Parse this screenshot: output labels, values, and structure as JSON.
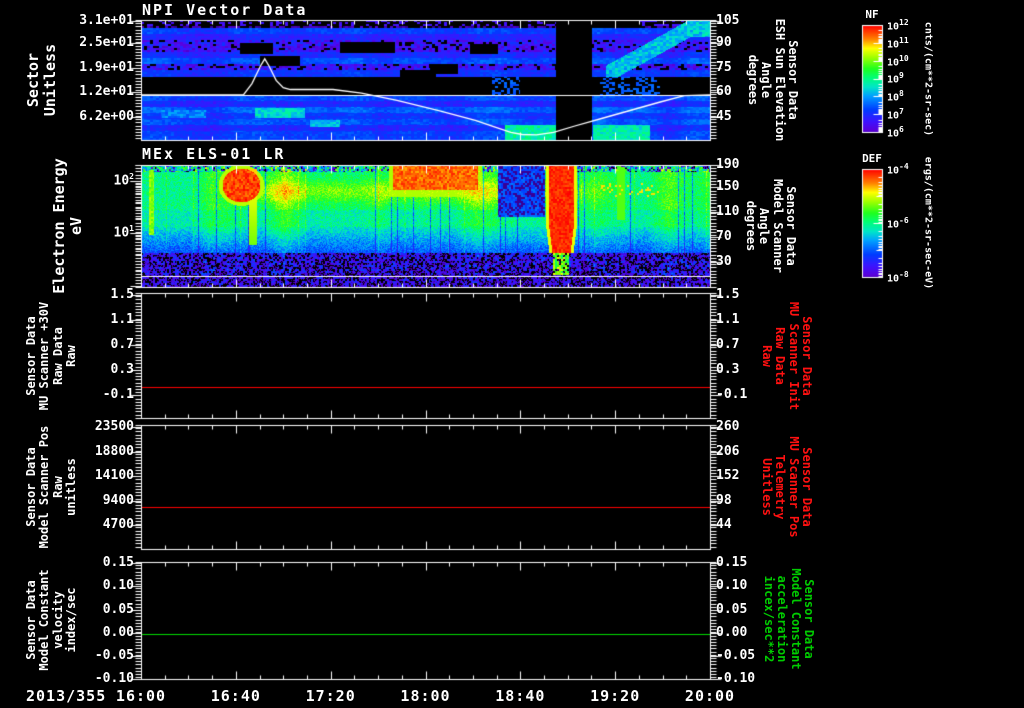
{
  "window": {
    "background": "#000000"
  },
  "date_label": "2013/355",
  "x_axis": {
    "tick_labels": [
      "16:00",
      "16:40",
      "17:20",
      "18:00",
      "18:40",
      "19:20",
      "20:00"
    ]
  },
  "colors": {
    "line_red": "#ff0000",
    "line_green": "#00dd00",
    "axis_white": "#ffffff",
    "title_red": "#ff1111",
    "title_green": "#00cc00"
  },
  "panels": [
    {
      "id": "npi",
      "title": "NPI Vector Data",
      "type": "spectrogram",
      "left_axis": {
        "title": "Sector\nUnitless",
        "ticks": [
          "3.1e+01",
          "2.5e+01",
          "1.9e+01",
          "1.2e+01",
          "6.2e+00"
        ],
        "fracs": [
          0.01,
          0.19,
          0.4,
          0.6,
          0.81
        ]
      },
      "right_axis": {
        "title": "Sensor Data\nESH Sun Elevation\nAngle\ndegrees",
        "color": "#ffffff",
        "ticks": [
          "105",
          "90",
          "75",
          "60",
          "45"
        ],
        "fracs": [
          0.01,
          0.19,
          0.4,
          0.6,
          0.81
        ]
      },
      "colorbar": {
        "title": "NF",
        "units": "cnts/(cm**2-sr-sec)",
        "tick_exponents": [
          "12",
          "11",
          "10",
          "9",
          "8",
          "7",
          "6"
        ]
      }
    },
    {
      "id": "els",
      "title": "MEx ELS-01 LR",
      "type": "spectrogram",
      "left_axis": {
        "title": "Electron Energy\neV",
        "ticks_pow": [
          "2",
          "1"
        ],
        "fracs_pow": [
          0.13,
          0.56
        ]
      },
      "right_axis": {
        "title": "Sensor Data\nModel Scanner\nAngle\ndegrees",
        "color": "#ffffff",
        "ticks": [
          "190",
          "150",
          "110",
          "70",
          "30"
        ],
        "fracs": [
          0.0,
          0.18,
          0.385,
          0.59,
          0.795
        ]
      },
      "colorbar": {
        "title": "DEF",
        "units": "ergs/(cm**2-sr-sec-eV)",
        "tick_exponents": [
          "-4",
          "-6",
          "-8"
        ]
      }
    },
    {
      "id": "mu-scanner-30v",
      "type": "line",
      "line_color": "#ff0000",
      "line_frac": 0.752,
      "left_axis": {
        "title": "Sensor Data\nMU Scanner +30V\nRaw Data\nRaw",
        "ticks": [
          "1.5",
          "1.1",
          "0.7",
          "0.3",
          "-0.1"
        ],
        "fracs": [
          0.016,
          0.216,
          0.416,
          0.616,
          0.816
        ]
      },
      "right_axis": {
        "title": "Sensor Data\nMU Scanner Init\nRaw Data\nRaw",
        "color": "#ff1111",
        "ticks": [
          "1.5",
          "1.1",
          "0.7",
          "0.3",
          "-0.1"
        ],
        "fracs": [
          0.016,
          0.216,
          0.416,
          0.616,
          0.816
        ]
      }
    },
    {
      "id": "model-scanner-pos",
      "type": "line",
      "line_color": "#ff0000",
      "line_frac": 0.66,
      "left_axis": {
        "title": "Sensor Data\nModel Scanner Pos\nRaw\nunitless",
        "ticks": [
          "23500",
          "18800",
          "14100",
          "9400",
          "4700"
        ],
        "fracs": [
          0.016,
          0.214,
          0.412,
          0.61,
          0.808
        ]
      },
      "right_axis": {
        "title": "Sensor Data\nMU Scanner Pos\nTelemetry\nUnitless",
        "color": "#ff1111",
        "ticks": [
          "260",
          "206",
          "152",
          "98",
          "44"
        ],
        "fracs": [
          0.016,
          0.214,
          0.412,
          0.61,
          0.808
        ]
      }
    },
    {
      "id": "model-constant",
      "type": "line",
      "line_color": "#00dd00",
      "line_frac": 0.615,
      "left_axis": {
        "title": "Sensor Data\nModel Constant\nvelocity\nindex/sec",
        "ticks": [
          "0.15",
          "0.10",
          "0.05",
          "0.00",
          "-0.05",
          "-0.10"
        ],
        "fracs": [
          0.01,
          0.208,
          0.406,
          0.604,
          0.802,
          1.0
        ]
      },
      "right_axis": {
        "title": "Sensor Data\nModel Constant\nacceleration\nincex/sec**2",
        "color": "#00cc00",
        "ticks": [
          "0.15",
          "0.10",
          "0.05",
          "0.00",
          "-0.05",
          "-0.10"
        ],
        "fracs": [
          0.01,
          0.208,
          0.406,
          0.604,
          0.802,
          1.0
        ]
      }
    }
  ],
  "chart_data": [
    {
      "type": "heatmap",
      "title": "NPI Vector Data",
      "date": "2013/355",
      "x_range_time": [
        "16:00",
        "20:00"
      ],
      "ylabel": "Sector (Unitless)",
      "y_ticks": [
        31,
        25,
        19,
        12,
        6.2
      ],
      "colorbar": {
        "name": "NF",
        "units": "cnts/(cm**2-sr-sec)",
        "scale": "log",
        "range_exponents": [
          6,
          12
        ]
      },
      "right_axis": {
        "label": "ESH Sun Elevation Angle (degrees)",
        "ticks": [
          105,
          90,
          75,
          60,
          45
        ]
      },
      "reference_line_degrees": 59,
      "overlay_line": {
        "name": "ESH Sun Elevation Angle",
        "units": "degrees",
        "x_hours": [
          16.0,
          16.72,
          16.78,
          16.84,
          16.87,
          16.9,
          16.95,
          17.0,
          17.05,
          17.35,
          17.55,
          17.8,
          18.1,
          18.35,
          18.5,
          18.6,
          18.68,
          18.78,
          18.9,
          19.05,
          19.25,
          19.45,
          19.65,
          19.82,
          20.0
        ],
        "y_degrees": [
          59,
          59,
          66,
          77,
          81.5,
          77,
          68,
          63.5,
          62.3,
          62.3,
          60,
          55.5,
          49,
          43,
          38.5,
          35.5,
          34.2,
          34.0,
          35.5,
          39.5,
          44.5,
          49.5,
          54.5,
          58.5,
          59
        ]
      },
      "notes": "blue/purple sector bands; black horizontal band sectors ~12-16; black data-gap column ~18:56-19:11"
    },
    {
      "type": "heatmap",
      "title": "MEx ELS-01 LR",
      "ylabel": "Electron Energy (eV)",
      "y_scale": "log",
      "y_ticks": [
        100,
        10
      ],
      "colorbar": {
        "name": "DEF",
        "units": "ergs/(cm**2-sr-sec-eV)",
        "scale": "log",
        "range_exponents": [
          -8,
          -4
        ]
      },
      "right_axis": {
        "label": "Model Scanner Angle (degrees)",
        "ticks": [
          190,
          150,
          110,
          70,
          30
        ]
      },
      "notes": "broad green flux 5-100 eV; yellow band ~40-90 eV; red enhancements ~16:35 and 17:45-18:20; dark gap then intense red column ~18:50-19:00"
    },
    {
      "type": "line",
      "name": "MU Scanner +30V Raw Data (Raw)",
      "x_range_hours": [
        16,
        20
      ],
      "constant_value": 0.0,
      "y_ticks": [
        1.5,
        1.1,
        0.7,
        0.3,
        -0.1
      ],
      "color": "#ff0000",
      "right_axis": {
        "label": "MU Scanner Init Raw Data (Raw)",
        "ticks": [
          1.5,
          1.1,
          0.7,
          0.3,
          -0.1
        ]
      }
    },
    {
      "type": "line",
      "name": "Model Scanner Pos Raw (unitless)",
      "x_range_hours": [
        16,
        20
      ],
      "constant_value": 8100,
      "y_ticks": [
        23500,
        18800,
        14100,
        9400,
        4700
      ],
      "color": "#ff0000",
      "right_axis": {
        "label": "MU Scanner Pos Telemetry (Unitless)",
        "ticks": [
          260,
          206,
          152,
          98,
          44
        ]
      }
    },
    {
      "type": "line",
      "name": "Model Constant velocity (index/sec)",
      "x_range_hours": [
        16,
        20
      ],
      "constant_value": 0.0,
      "y_ticks": [
        0.15,
        0.1,
        0.05,
        0.0,
        -0.05,
        -0.1
      ],
      "color": "#00dd00",
      "right_axis": {
        "label": "Model Constant acceleration (incex/sec**2)",
        "ticks": [
          0.15,
          0.1,
          0.05,
          0.0,
          -0.05,
          -0.1
        ]
      }
    }
  ]
}
